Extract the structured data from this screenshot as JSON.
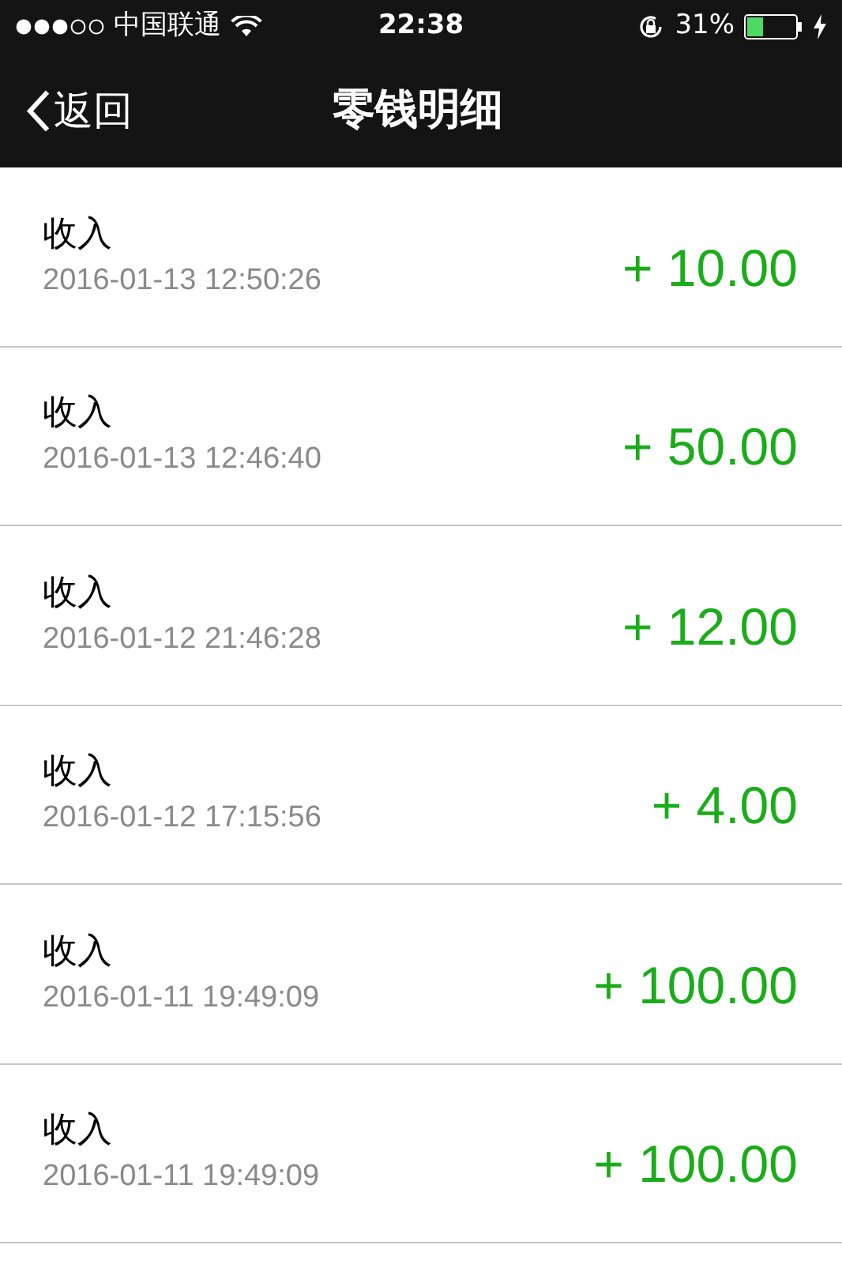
{
  "status_bar": {
    "carrier": "中国联通",
    "time": "22:38",
    "battery": "31%"
  },
  "nav_bar": {
    "back": "返回",
    "title": "零钱明细"
  },
  "transactions": [
    {
      "type": "收入",
      "time": "2016-01-13 12:50:26",
      "amount": "+ 10.00"
    },
    {
      "type": "收入",
      "time": "2016-01-13 12:46:40",
      "amount": "+ 50.00"
    },
    {
      "type": "收入",
      "time": "2016-01-12 21:46:28",
      "amount": "+ 12.00"
    },
    {
      "type": "收入",
      "time": "2016-01-12 17:15:56",
      "amount": "+ 4.00"
    },
    {
      "type": "收入",
      "time": "2016-01-11 19:49:09",
      "amount": "+ 100.00"
    },
    {
      "type": "收入",
      "time": "2016-01-11 19:49:09",
      "amount": "+ 100.00"
    }
  ]
}
